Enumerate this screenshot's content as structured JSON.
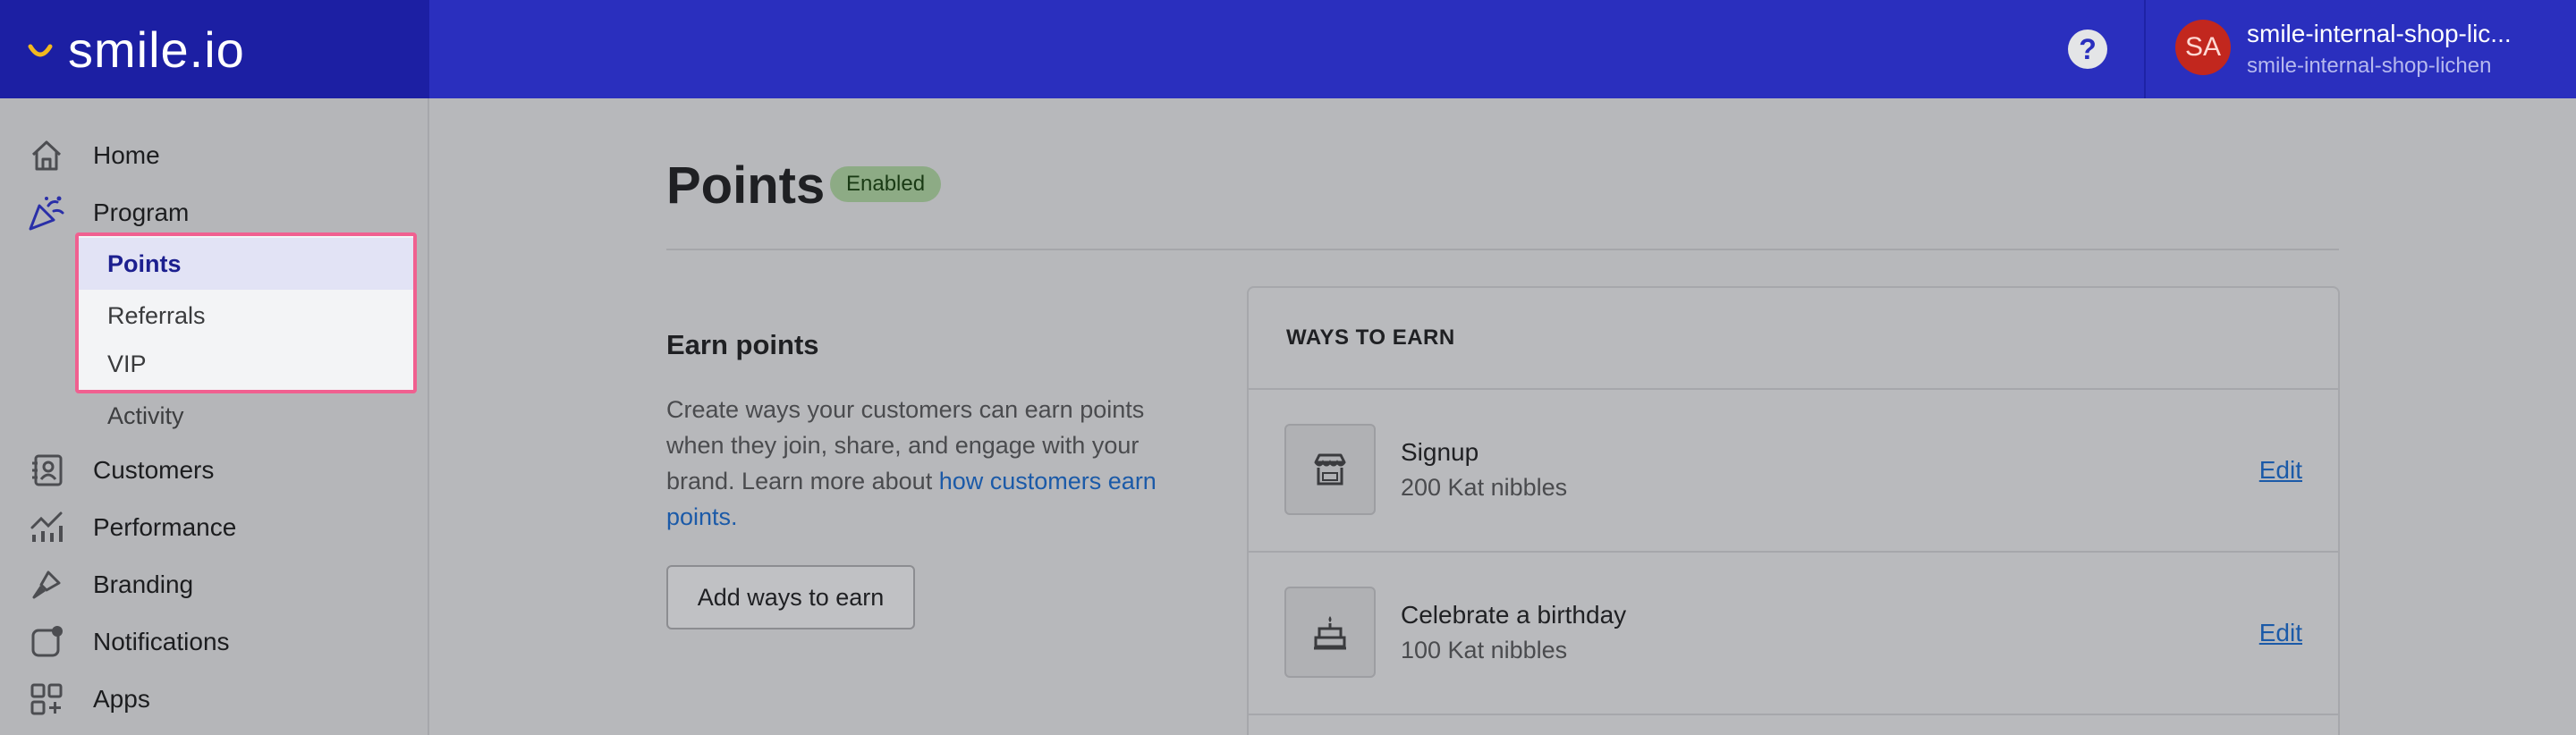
{
  "header": {
    "brand": "smile.io",
    "help_label": "?",
    "avatar_initials": "SA",
    "shop_name": "smile-internal-shop-lic...",
    "shop_handle": "smile-internal-shop-lichen"
  },
  "sidebar": {
    "items": [
      {
        "label": "Home",
        "icon": "home-icon"
      },
      {
        "label": "Program",
        "icon": "party-popper-icon"
      },
      {
        "label": "Customers",
        "icon": "contacts-icon"
      },
      {
        "label": "Performance",
        "icon": "chart-icon"
      },
      {
        "label": "Branding",
        "icon": "paintbrush-icon"
      },
      {
        "label": "Notifications",
        "icon": "notification-icon"
      },
      {
        "label": "Apps",
        "icon": "apps-icon"
      }
    ],
    "program_sub": [
      "Points",
      "Referrals",
      "VIP",
      "Activity"
    ]
  },
  "page": {
    "title": "Points",
    "status_badge": "Enabled"
  },
  "earn": {
    "title": "Earn points",
    "description": "Create ways your customers can earn points when they join, share, and engage with your brand. Learn more about",
    "link_text": "how customers earn points.",
    "add_button": "Add ways to earn"
  },
  "ways_to_earn": {
    "heading": "WAYS TO EARN",
    "items": [
      {
        "title": "Signup",
        "reward": "200 Kat nibbles",
        "action": "Edit",
        "icon": "storefront-icon"
      },
      {
        "title": "Celebrate a birthday",
        "reward": "100 Kat nibbles",
        "action": "Edit",
        "icon": "birthday-cake-icon"
      }
    ]
  },
  "colors": {
    "topbar": "#2a2fbe",
    "brand_panel": "#1c1fa3",
    "highlight_border": "#f06090",
    "link": "#1b5aa8",
    "badge": "#8dab85"
  }
}
